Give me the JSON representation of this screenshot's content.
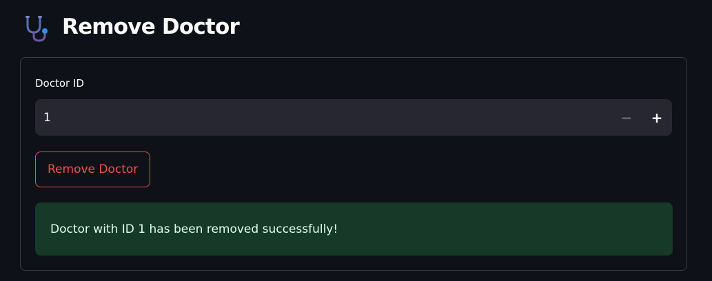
{
  "header": {
    "icon": "stethoscope-icon",
    "title": "Remove Doctor"
  },
  "form": {
    "doctor_id_label": "Doctor ID",
    "doctor_id_value": "1",
    "decrement_symbol": "−",
    "increment_symbol": "+",
    "submit_label": "Remove Doctor"
  },
  "alert": {
    "message": "Doctor with ID 1 has been removed successfully!"
  },
  "colors": {
    "background": "#0e1117",
    "input_bg": "#262730",
    "accent_red": "#ff4b4b",
    "success_bg": "#173928",
    "success_text": "#dffde9"
  }
}
